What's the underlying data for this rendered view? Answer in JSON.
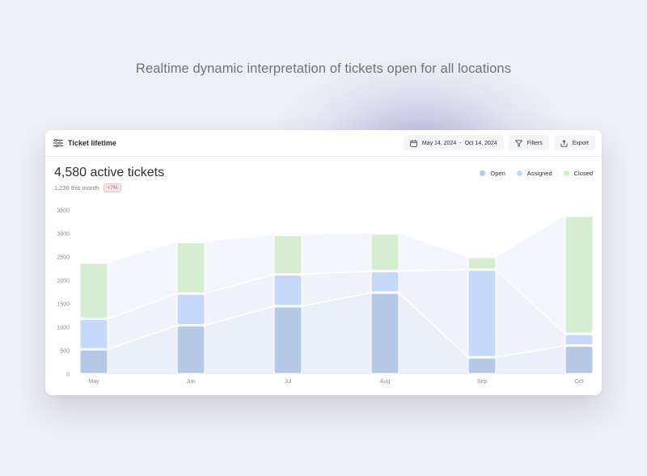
{
  "headline": "Realtime dynamic interpretation of tickets open for all locations",
  "card": {
    "title": "Ticket lifetime",
    "title_icon": "list-icon",
    "date_start": "May 14, 2024",
    "date_sep": "-",
    "date_end": "Oct 14, 2024",
    "filters_label": "Filters",
    "export_label": "Export",
    "active_tickets": "4,580 active tickets",
    "this_month": "1,236 this month",
    "change_badge": "+7%"
  },
  "colors": {
    "open": "#b5c9e6",
    "assigned": "#c5d8f9",
    "closed": "#d6edd2",
    "badge": "#e0445a"
  },
  "chart_data": {
    "type": "bar",
    "stacked": true,
    "categories": [
      "May",
      "Jun",
      "Jul",
      "Aug",
      "Sep",
      "Oct"
    ],
    "series": [
      {
        "name": "Open",
        "values": [
          530,
          1040,
          1450,
          1740,
          360,
          610
        ]
      },
      {
        "name": "Assigned",
        "values": [
          650,
          680,
          680,
          460,
          1870,
          250
        ]
      },
      {
        "name": "Closed",
        "values": [
          1200,
          1100,
          840,
          800,
          270,
          2520
        ]
      }
    ],
    "yticks": [
      "0",
      "500",
      "1000",
      "1500",
      "2000",
      "2500",
      "3000",
      "3500"
    ],
    "ylim": [
      0,
      3500
    ],
    "legend": "top-right",
    "grid": false
  }
}
